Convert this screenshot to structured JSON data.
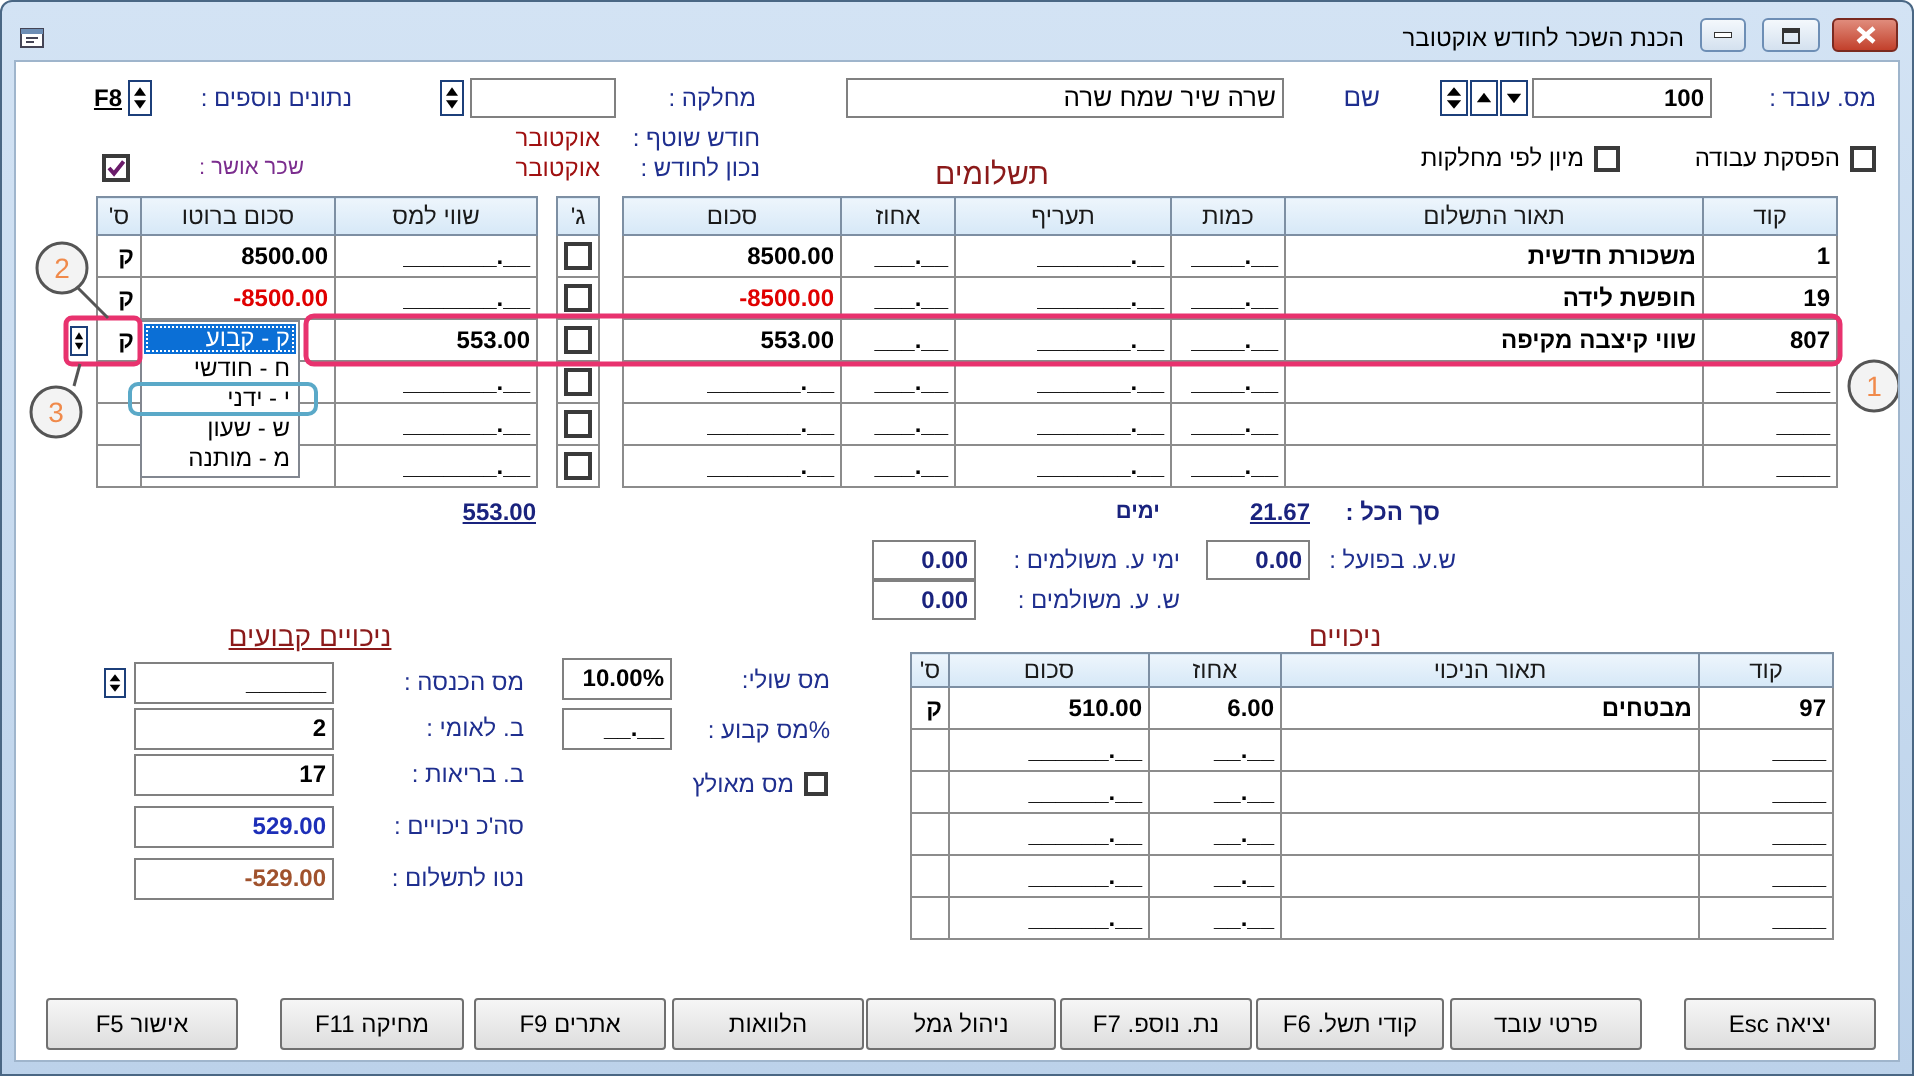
{
  "window": {
    "title": "הכנת השכר לחודש אוקטובר"
  },
  "header": {
    "employee_no": {
      "label": "מס. עובד :",
      "value": "100"
    },
    "name": {
      "label": "שם",
      "value": "שרה שיר שמח שרה"
    },
    "department": {
      "label": "מחלקה :"
    },
    "extra_data": {
      "label": "נתונים נוספים :",
      "hotkey": "F8"
    },
    "current_month": {
      "label": "חודש שוטף :",
      "value": "אוקטובר"
    },
    "as_of_month": {
      "label": "נכון לחודש :",
      "value": "אוקטובר"
    },
    "options": [
      {
        "label": "הפסקת עבודה",
        "checked": false
      },
      {
        "label": "מיון לפי מחלקות",
        "checked": false
      }
    ],
    "salary_approved": {
      "label": "שכר אושר :",
      "checked": true
    }
  },
  "payments": {
    "title": "תשלומים",
    "columns": [
      "קוד",
      "תאור התשלום",
      "כמות",
      "תעריף",
      "אחוז",
      "סכום"
    ],
    "check_column": "ג'",
    "side_columns": [
      "שווי למס",
      "סכום ברוטו",
      "ס'"
    ],
    "rows": [
      {
        "code": "1",
        "description": "משכורת חדשית",
        "quantity": "____.__",
        "rate": "_______.__",
        "percent": "___.__",
        "amount": "8500.00",
        "negative": false,
        "g_checked": false,
        "tax_value": "_______.__",
        "gross": "8500.00",
        "s": "ק",
        "editing": false
      },
      {
        "code": "19",
        "description": "חופשת לידה",
        "quantity": "____.__",
        "rate": "_______.__",
        "percent": "___.__",
        "amount": "-8500.00",
        "negative": true,
        "g_checked": false,
        "tax_value": "_______.__",
        "gross": "-8500.00",
        "s": "ק",
        "editing": false
      },
      {
        "code": "807",
        "description": "שווי קיצבה מקיפה",
        "quantity": "____.__",
        "rate": "_______.__",
        "percent": "___.__",
        "amount": "553.00",
        "negative": false,
        "g_checked": false,
        "tax_value": "553.00",
        "s": "ק",
        "editing": true
      },
      {
        "code": "____",
        "quantity": "____.__",
        "rate": "_______.__",
        "percent": "___.__",
        "amount": "_______.__",
        "negative": false,
        "g_checked": false,
        "tax_value": "_______.__",
        "editing": false
      },
      {
        "code": "____",
        "quantity": "____.__",
        "rate": "_______.__",
        "percent": "___.__",
        "amount": "_______.__",
        "negative": false,
        "g_checked": false,
        "tax_value": "_______.__",
        "editing": false
      },
      {
        "code": "____",
        "quantity": "____.__",
        "rate": "_______.__",
        "percent": "___.__",
        "amount": "_______.__",
        "negative": false,
        "g_checked": false,
        "tax_value": "_______.__",
        "editing": false
      }
    ],
    "type_dropdown": {
      "options": [
        {
          "label": "ק - קבוע",
          "selected": true
        },
        {
          "label": "ח - חודשי",
          "selected": false
        },
        {
          "label": "י - ידני",
          "selected": false
        },
        {
          "label": "ש - שעון",
          "selected": false
        },
        {
          "label": "מ - מותנה",
          "selected": false
        }
      ]
    }
  },
  "totals": {
    "gross_total": "553.00",
    "label": "סך הכל :",
    "days": "21.67",
    "days_unit": "ימים",
    "fields": [
      {
        "label": "ש.ע. בפועל :",
        "value": "0.00"
      },
      {
        "label": "ימי ע. משולמים :",
        "value": "0.00"
      },
      {
        "label": "ש. ע. משולמים :",
        "value": "0.00"
      }
    ]
  },
  "deductions": {
    "title": "ניכויים",
    "columns": [
      "קוד",
      "תאור הניכוי",
      "אחוז",
      "סכום",
      "ס'"
    ],
    "rows": [
      {
        "code": "97",
        "description": "מבטחים",
        "percent": "6.00",
        "amount": "510.00",
        "s": "ק"
      },
      {
        "code": "____",
        "percent": "__.__",
        "amount": "______.__"
      },
      {
        "code": "____",
        "percent": "__.__",
        "amount": "______.__"
      },
      {
        "code": "____",
        "percent": "__.__",
        "amount": "______.__"
      },
      {
        "code": "____",
        "percent": "__.__",
        "amount": "______.__"
      },
      {
        "code": "____",
        "percent": "__.__",
        "amount": "______.__"
      }
    ]
  },
  "fixed_deductions": {
    "title": "ניכויים קבועים",
    "fields": [
      {
        "label": "מס הכנסה :",
        "value": "______",
        "kind": "plain"
      },
      {
        "label": "ב. לאומי :",
        "value": "2",
        "kind": "plain"
      },
      {
        "label": "ב. בריאות :",
        "value": "17",
        "kind": "plain"
      },
      {
        "label": "סה'כ ניכויים :",
        "value": "529.00",
        "kind": "total"
      },
      {
        "label": "נטו לתשלום :",
        "value": "-529.00",
        "kind": "net"
      }
    ],
    "marginal_tax": {
      "label": "מס שולי:",
      "value": "10.00%"
    },
    "fixed_tax": {
      "label": "%מס קבוע :",
      "value": "__.__"
    },
    "forced_tax": {
      "label": "מס מאולץ",
      "checked": false
    }
  },
  "buttons": [
    "יציאה Esc",
    "פרטי עובד",
    "קודי תשל. F6",
    "נת. נוספ. F7",
    "ניהול גמל",
    "הלוואות",
    "אתרים F9",
    "מחיקה F11",
    "אישור F5"
  ],
  "callouts": [
    {
      "label": "1"
    },
    {
      "label": "2"
    },
    {
      "label": "3"
    }
  ]
}
